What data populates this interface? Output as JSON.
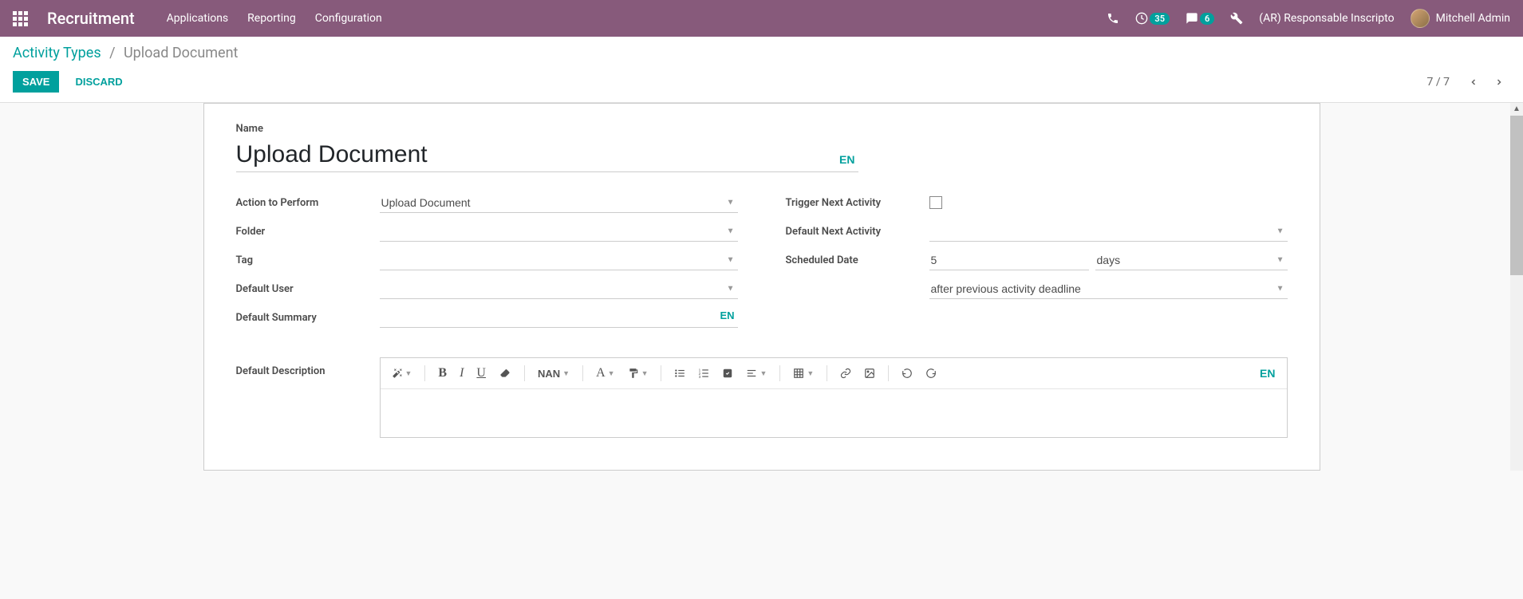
{
  "navbar": {
    "brand": "Recruitment",
    "menu": {
      "applications": "Applications",
      "reporting": "Reporting",
      "configuration": "Configuration"
    },
    "activities_badge": "35",
    "messages_badge": "6",
    "company": "(AR) Responsable Inscripto",
    "user_name": "Mitchell Admin"
  },
  "breadcrumb": {
    "parent": "Activity Types",
    "current": "Upload Document"
  },
  "buttons": {
    "save": "Save",
    "discard": "Discard"
  },
  "pager": {
    "text": "7 / 7"
  },
  "form": {
    "name_label": "Name",
    "name_value": "Upload Document",
    "lang_code": "EN",
    "labels": {
      "action": "Action to Perform",
      "folder": "Folder",
      "tag": "Tag",
      "default_user": "Default User",
      "default_summary": "Default Summary",
      "trigger_next": "Trigger Next Activity",
      "default_next": "Default Next Activity",
      "scheduled_date": "Scheduled Date",
      "default_description": "Default Description"
    },
    "action_value": "Upload Document",
    "folder_value": "",
    "tag_value": "",
    "default_user_value": "",
    "default_summary_value": "",
    "trigger_next_checked": false,
    "default_next_value": "",
    "scheduled_date_value": "5",
    "scheduled_date_unit": "days",
    "scheduled_date_relative": "after previous activity deadline"
  },
  "editor": {
    "size_label": "NAN"
  }
}
